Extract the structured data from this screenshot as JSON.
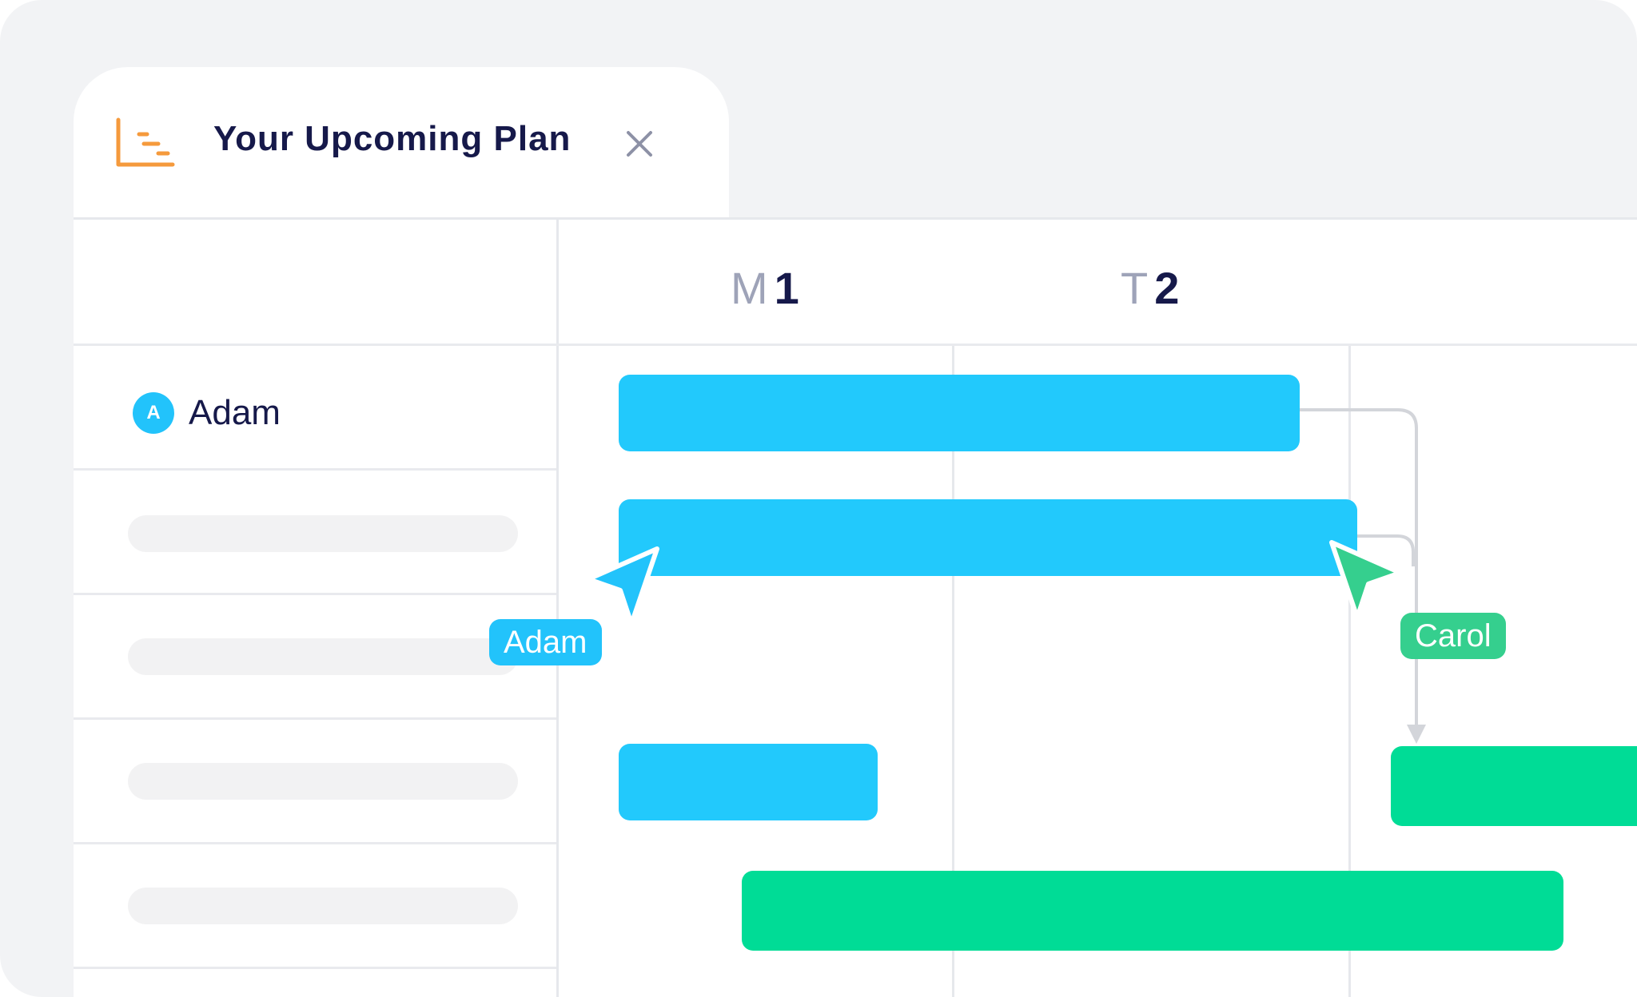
{
  "tab": {
    "icon": "gantt-chart-icon",
    "title": "Your Upcoming Plan",
    "close_icon": "close-icon"
  },
  "timeline": {
    "days": [
      {
        "letter": "M",
        "number": "1"
      },
      {
        "letter": "T",
        "number": "2"
      }
    ]
  },
  "rows": {
    "first": {
      "avatar_initial": "A",
      "name": "Adam"
    }
  },
  "cursors": [
    {
      "name": "Adam",
      "color": "#22c3fb",
      "icon": "pointer-cursor-icon"
    },
    {
      "name": "Carol",
      "color": "#35cf8e",
      "icon": "pointer-cursor-icon"
    }
  ],
  "colors": {
    "accent_orange": "#f59a3c",
    "task_blue": "#22c9fc",
    "task_green": "#00dc96",
    "title_navy": "#16194a"
  }
}
